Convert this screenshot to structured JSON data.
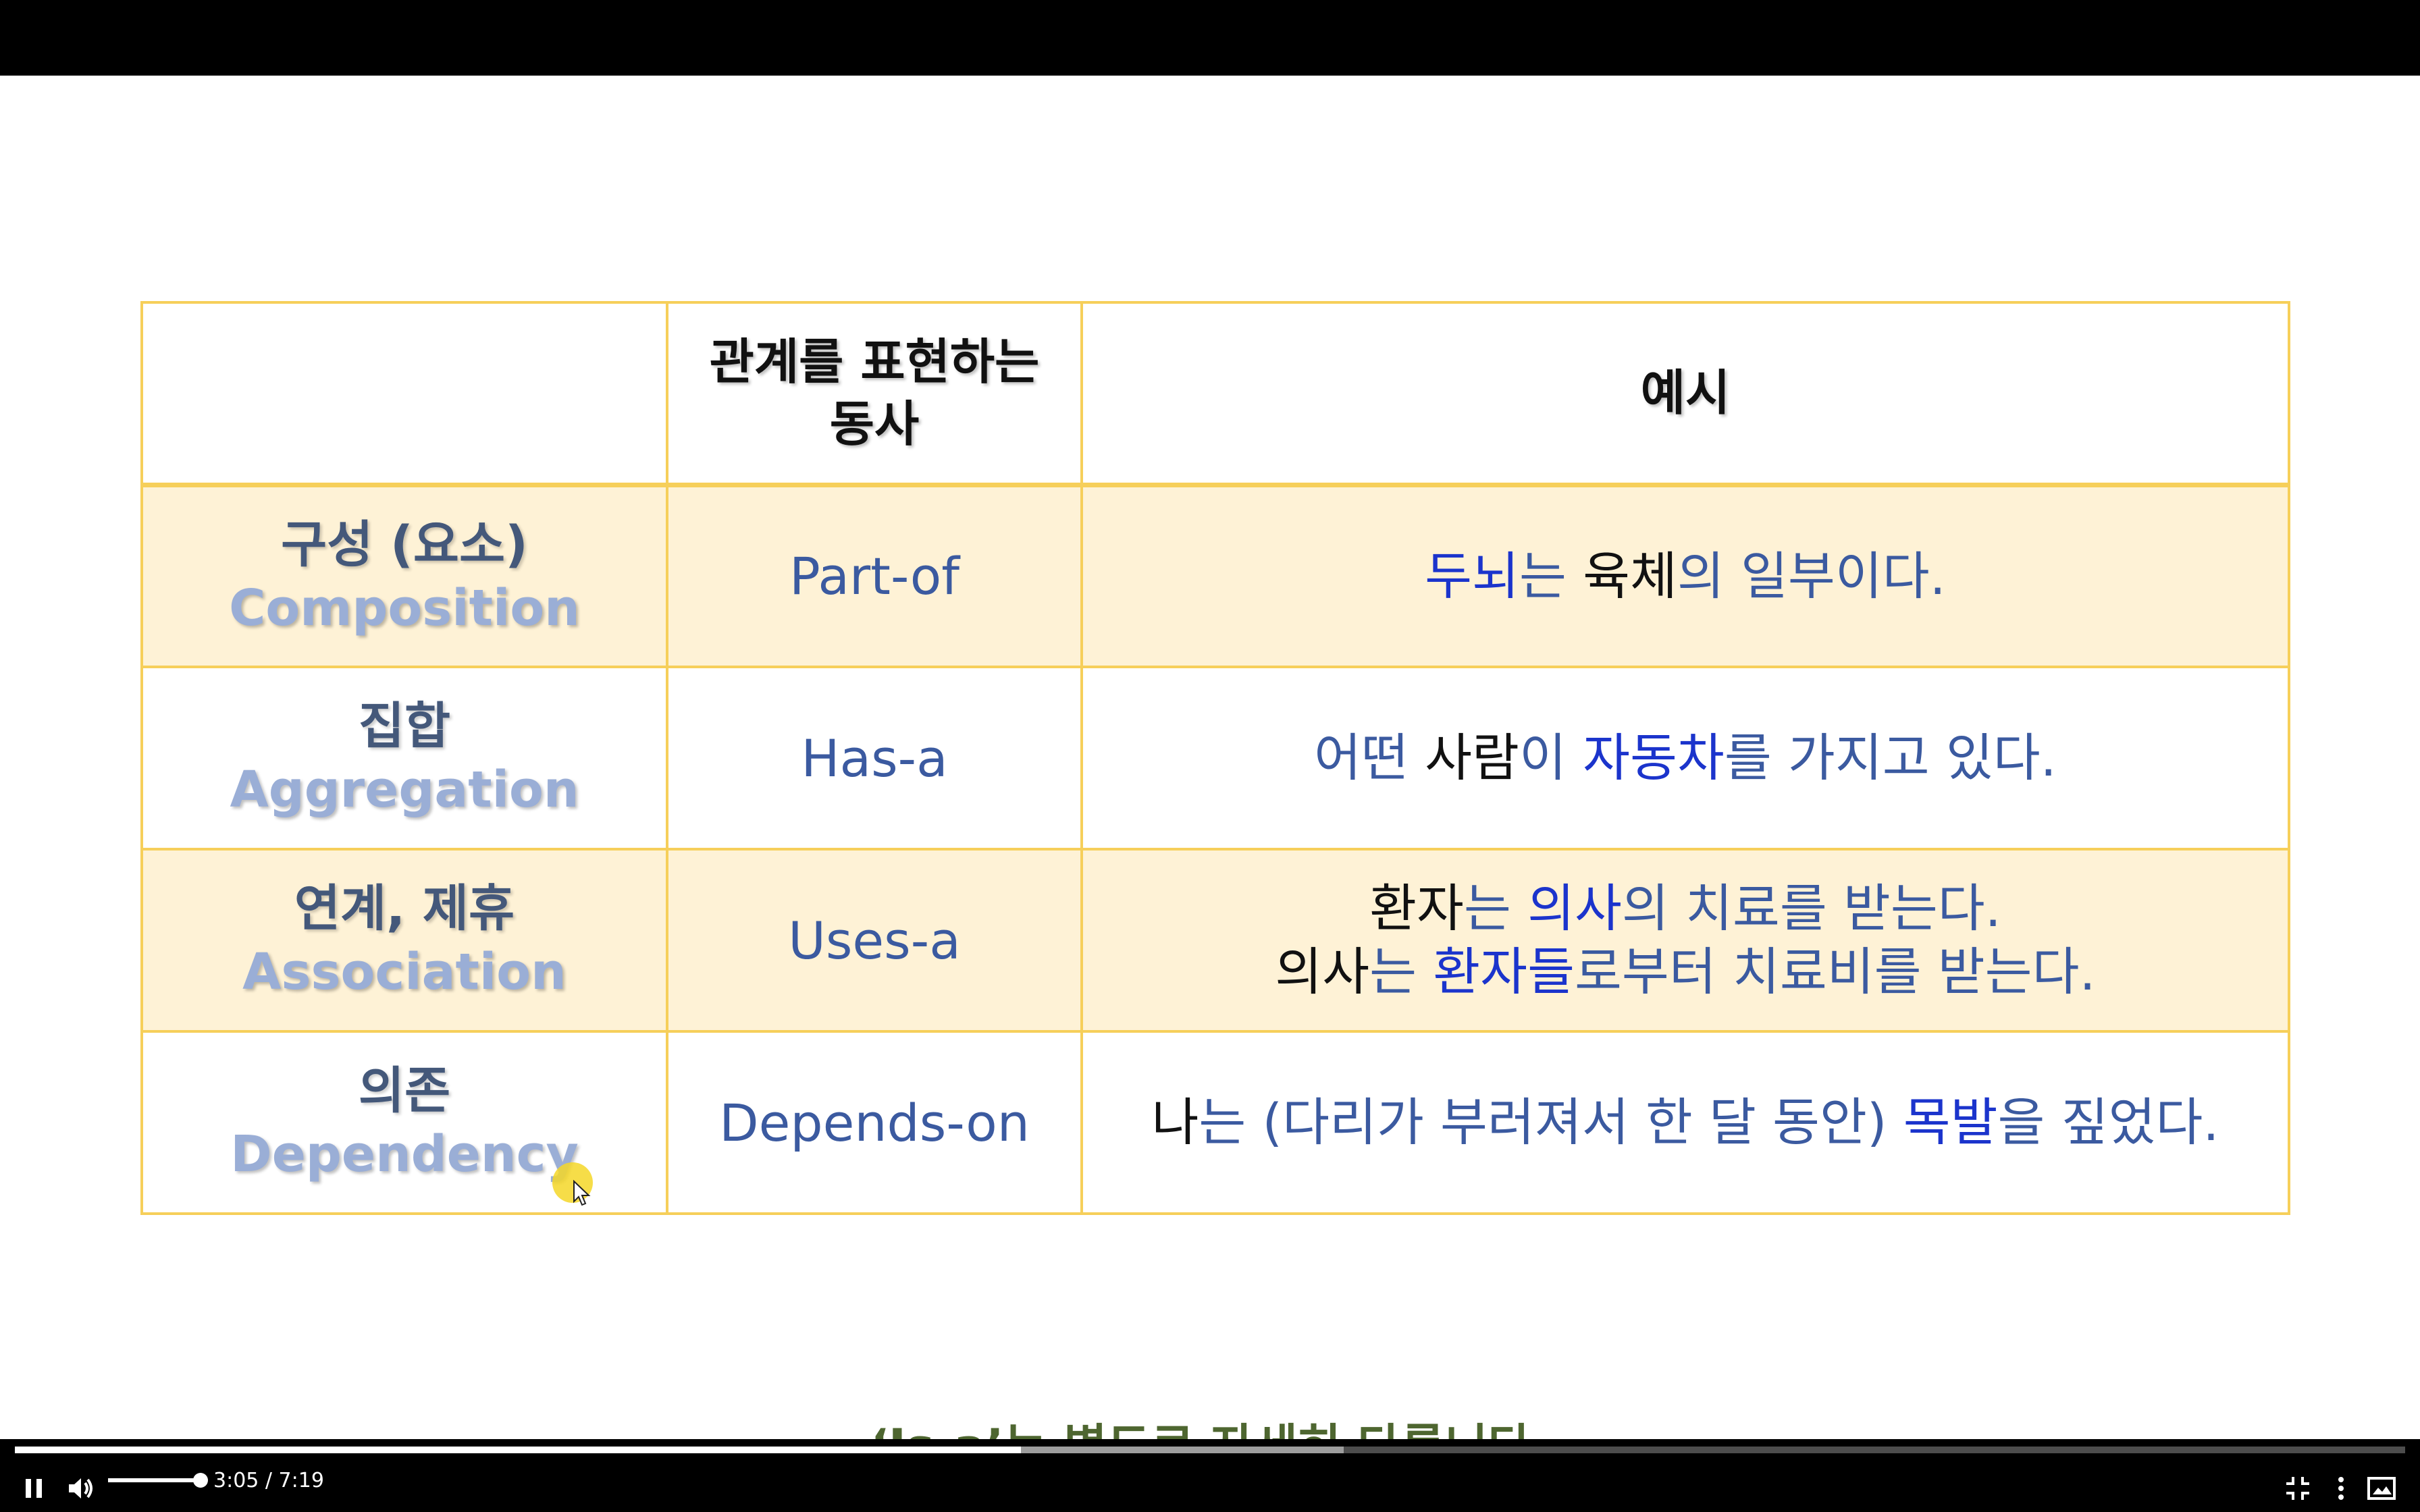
{
  "table": {
    "headers": [
      "",
      "관계를 표현하는 동사",
      "예시"
    ],
    "header_lines": {
      "verb_line1": "관계를 표현하는",
      "verb_line2": "동사",
      "example": "예시"
    },
    "rows": [
      {
        "korean": "구성 (요소)",
        "english": "Composition",
        "verb": "Part-of",
        "example_lines": [
          [
            {
              "t": "두뇌",
              "s": "d"
            },
            {
              "t": "는 ",
              "s": "c"
            },
            {
              "t": "육체",
              "s": "b"
            },
            {
              "t": "의 일부이다.",
              "s": "c"
            }
          ]
        ]
      },
      {
        "korean": "집합",
        "english": "Aggregation",
        "verb": "Has-a",
        "example_lines": [
          [
            {
              "t": "어떤 ",
              "s": "c"
            },
            {
              "t": "사람",
              "s": "b"
            },
            {
              "t": "이 ",
              "s": "c"
            },
            {
              "t": "자동차",
              "s": "d"
            },
            {
              "t": "를 가지고 있다.",
              "s": "c"
            }
          ]
        ]
      },
      {
        "korean": "연계, 제휴",
        "english": "Association",
        "verb": "Uses-a",
        "example_lines": [
          [
            {
              "t": "환자",
              "s": "b"
            },
            {
              "t": "는 ",
              "s": "c"
            },
            {
              "t": "의사",
              "s": "d"
            },
            {
              "t": "의 치료를 받는다.",
              "s": "c"
            }
          ],
          [
            {
              "t": "의사",
              "s": "b"
            },
            {
              "t": "는 ",
              "s": "c"
            },
            {
              "t": "환자들",
              "s": "d"
            },
            {
              "t": "로부터 치료비를 받는다.",
              "s": "c"
            }
          ]
        ]
      },
      {
        "korean": "의존",
        "english": "Dependency",
        "verb": "Depends-on",
        "example_lines": [
          [
            {
              "t": "나",
              "s": "b"
            },
            {
              "t": "는 (다리가 부러져서 한 달 동안) ",
              "s": "c"
            },
            {
              "t": "목발",
              "s": "d"
            },
            {
              "t": "을 짚었다.",
              "s": "c"
            }
          ]
        ]
      }
    ]
  },
  "note": "‘Is-a’는 별도로 자세히 다룹니다.",
  "player": {
    "current_time": "3:05",
    "duration": "7:19",
    "time_display": "3:05 / 7:19",
    "progress_fraction": 0.421,
    "buffered_fraction": 0.556,
    "volume_fraction": 0.9,
    "icons": [
      "pause-icon",
      "volume-icon",
      "exit-fullscreen-icon",
      "more-options-icon",
      "picture-in-picture-icon"
    ]
  },
  "colors": {
    "table_border": "#f6cf5a",
    "row_fill": "#fef2d6",
    "subject_black": "#111111",
    "body_blue": "#3b5aa0",
    "highlight_blue": "#1b34cc",
    "note_green": "#4e6630"
  }
}
